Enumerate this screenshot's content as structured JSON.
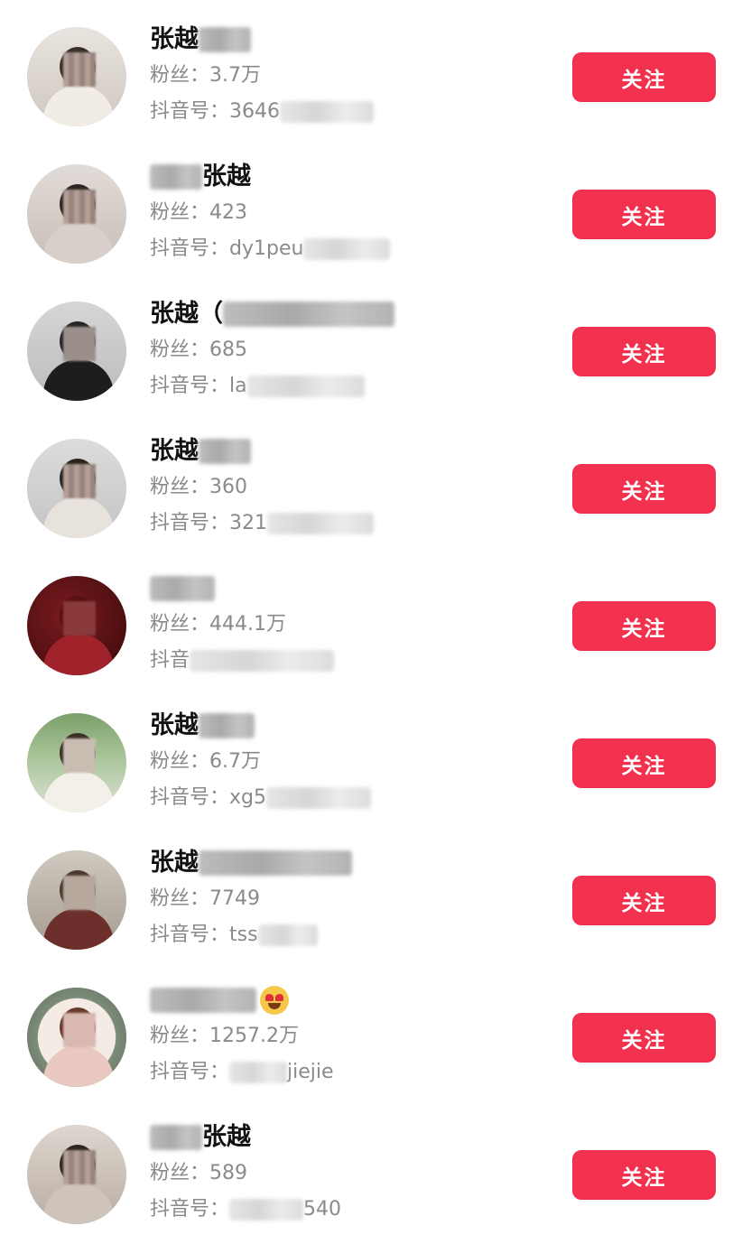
{
  "users": [
    {
      "name": "张越",
      "followers_label": "粉丝：",
      "followers": "3.7万",
      "id_label": "抖音号：",
      "id_visible": "3646",
      "follow_label": "关注"
    },
    {
      "name": "张越",
      "followers_label": "粉丝：",
      "followers": "423",
      "id_label": "抖音号：",
      "id_visible": "dy1peu",
      "follow_label": "关注"
    },
    {
      "name": "张越（",
      "followers_label": "粉丝：",
      "followers": "685",
      "id_label": "抖音号：",
      "id_visible": "la",
      "follow_label": "关注"
    },
    {
      "name": "张越",
      "followers_label": "粉丝：",
      "followers": "360",
      "id_label": "抖音号：",
      "id_visible": "321",
      "follow_label": "关注"
    },
    {
      "name": "",
      "followers_label": "粉丝：",
      "followers": "444.1万",
      "id_label": "抖音",
      "id_visible": "",
      "follow_label": "关注"
    },
    {
      "name": "张越",
      "followers_label": "粉丝：",
      "followers": "6.7万",
      "id_label": "抖音号：",
      "id_visible": "xg5",
      "follow_label": "关注"
    },
    {
      "name": "张越",
      "followers_label": "粉丝：",
      "followers": "7749",
      "id_label": "抖音号：",
      "id_visible": "tss",
      "follow_label": "关注"
    },
    {
      "name": "",
      "followers_label": "粉丝：",
      "followers": "1257.2万",
      "id_label": "抖音号：",
      "id_visible": "jiejie",
      "follow_label": "关注"
    },
    {
      "name": "张越",
      "followers_label": "粉丝：",
      "followers": "589",
      "id_label": "抖音号：",
      "id_visible": "540",
      "follow_label": "关注"
    }
  ],
  "colors": {
    "follow_button": "#f2314f",
    "follow_text": "#ffffff",
    "name_text": "#111111",
    "meta_text": "#8a8a8a"
  }
}
